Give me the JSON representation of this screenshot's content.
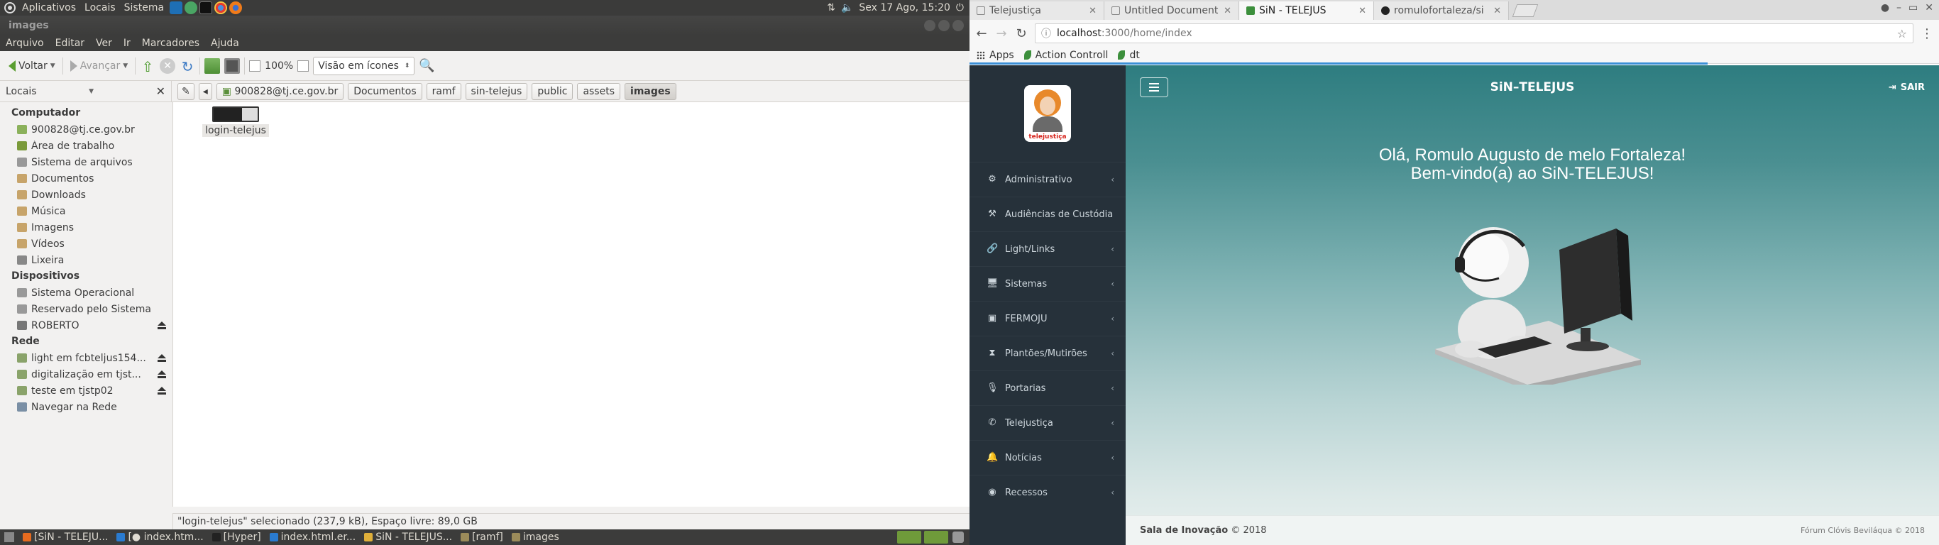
{
  "top_panel": {
    "menus": [
      "Aplicativos",
      "Locais",
      "Sistema"
    ],
    "clock": "Sex 17 Ago, 15:20"
  },
  "file_manager": {
    "title": "images",
    "menu": [
      "Arquivo",
      "Editar",
      "Ver",
      "Ir",
      "Marcadores",
      "Ajuda"
    ],
    "toolbar": {
      "back_label": "Voltar",
      "forward_label": "Avançar",
      "zoom": "100%",
      "view_mode": "Visão em ícones"
    },
    "side_header": "Locais",
    "breadcrumbs": [
      "900828@tj.ce.gov.br",
      "Documentos",
      "ramf",
      "sin-telejus",
      "public",
      "assets",
      "images"
    ],
    "sidebar": [
      {
        "group": "Computador",
        "items": [
          {
            "label": "900828@tj.ce.gov.br",
            "icon": "home-folder-icon",
            "eject": false
          },
          {
            "label": "Área de trabalho",
            "icon": "desktop-icon",
            "eject": false
          },
          {
            "label": "Sistema de arquivos",
            "icon": "drive-icon",
            "eject": false
          },
          {
            "label": "Documentos",
            "icon": "folder-icon",
            "eject": false
          },
          {
            "label": "Downloads",
            "icon": "download-folder-icon",
            "eject": false
          },
          {
            "label": "Música",
            "icon": "music-folder-icon",
            "eject": false
          },
          {
            "label": "Imagens",
            "icon": "pictures-folder-icon",
            "eject": false
          },
          {
            "label": "Vídeos",
            "icon": "videos-folder-icon",
            "eject": false
          },
          {
            "label": "Lixeira",
            "icon": "trash-icon",
            "eject": false
          }
        ]
      },
      {
        "group": "Dispositivos",
        "items": [
          {
            "label": "Sistema Operacional",
            "icon": "drive-icon",
            "eject": false
          },
          {
            "label": "Reservado pelo Sistema",
            "icon": "drive-icon",
            "eject": false
          },
          {
            "label": "ROBERTO",
            "icon": "usb-drive-icon",
            "eject": true
          }
        ]
      },
      {
        "group": "Rede",
        "items": [
          {
            "label": "light em fcbteljus154...",
            "icon": "network-folder-icon",
            "eject": true
          },
          {
            "label": "digitalização em tjst...",
            "icon": "network-folder-icon",
            "eject": true
          },
          {
            "label": "teste em tjstp02",
            "icon": "network-folder-icon",
            "eject": true
          },
          {
            "label": "Navegar na Rede",
            "icon": "network-icon",
            "eject": false
          }
        ]
      }
    ],
    "files": [
      {
        "name": "login-telejus",
        "selected": true
      }
    ],
    "status": "\"login-telejus\" selecionado (237,9 kB), Espaço livre: 89,0 GB"
  },
  "taskbar": {
    "tasks": [
      {
        "label": "[SiN - TELEJU...",
        "icon": "firefox-icon"
      },
      {
        "label": "[● index.htm...",
        "icon": "vscode-icon"
      },
      {
        "label": "[Hyper]",
        "icon": "terminal-icon"
      },
      {
        "label": "index.html.er...",
        "icon": "vscode-icon"
      },
      {
        "label": "SiN - TELEJUS...",
        "icon": "chrome-icon"
      },
      {
        "label": "[ramf]",
        "icon": "folder-icon"
      },
      {
        "label": "images",
        "icon": "folder-icon"
      }
    ]
  },
  "browser": {
    "tabs": [
      {
        "title": "Telejustiça",
        "active": false
      },
      {
        "title": "Untitled Document",
        "active": false
      },
      {
        "title": "SiN - TELEJUS",
        "active": true
      },
      {
        "title": "romulofortaleza/si",
        "active": false
      }
    ],
    "url_host": "localhost",
    "url_path": ":3000/home/index",
    "bookmarks": [
      "Apps",
      "Action Controll",
      "dt"
    ]
  },
  "app": {
    "logo_text": "telejustiça",
    "title": "SiN–TELEJUS",
    "logout": "SAIR",
    "greeting_line1": "Olá, Romulo Augusto de melo Fortaleza!",
    "greeting_line2": "Bem-vindo(a) ao SiN-TELEJUS!",
    "menu": [
      {
        "label": "Administrativo",
        "icon": "cogs-icon",
        "chevron": true
      },
      {
        "label": "Audiências de Custódia",
        "icon": "gavel-icon",
        "chevron": false
      },
      {
        "label": "Light/Links",
        "icon": "link-icon",
        "chevron": true
      },
      {
        "label": "Sistemas",
        "icon": "desktop-icon",
        "chevron": true
      },
      {
        "label": "FERMOJU",
        "icon": "money-icon",
        "chevron": true
      },
      {
        "label": "Plantões/Mutirões",
        "icon": "hourglass-icon",
        "chevron": true
      },
      {
        "label": "Portarias",
        "icon": "microphone-icon",
        "chevron": true
      },
      {
        "label": "Telejustiça",
        "icon": "phone-icon",
        "chevron": true
      },
      {
        "label": "Notícias",
        "icon": "bell-icon",
        "chevron": true
      },
      {
        "label": "Recessos",
        "icon": "compass-icon",
        "chevron": true
      }
    ],
    "footer_left_bold": "Sala de Inovação",
    "footer_left_rest": " © 2018",
    "footer_right": "Fórum Clóvis Beviláqua © 2018"
  },
  "colors": {
    "sidebar_bg": "#26313a",
    "header_teal": "#2e7d80",
    "tab_loading": "#3b8fd6"
  }
}
